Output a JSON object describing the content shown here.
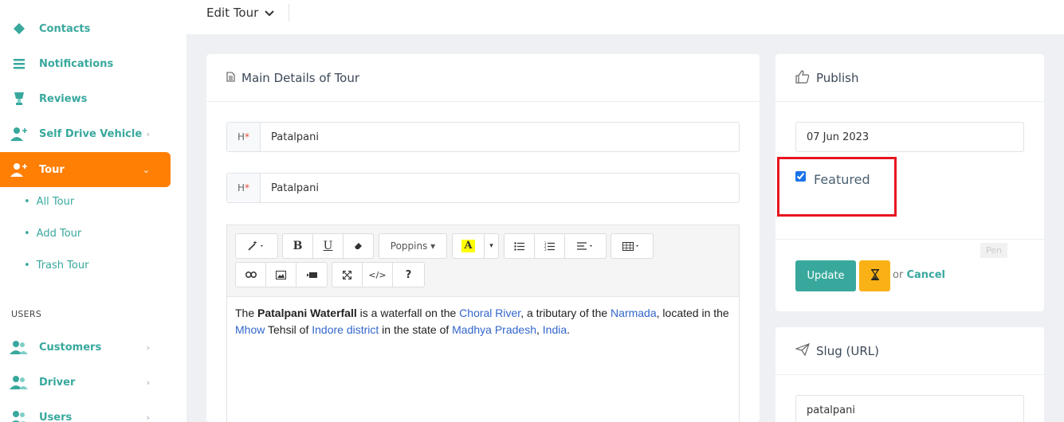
{
  "sidebar": {
    "items": [
      {
        "label": "Contacts",
        "icon": "layers-icon"
      },
      {
        "label": "Notifications",
        "icon": "list-icon"
      },
      {
        "label": "Reviews",
        "icon": "trophy-icon"
      },
      {
        "label": "Self Drive Vehicle",
        "icon": "user-plus-icon"
      },
      {
        "label": "Tour",
        "icon": "user-plus-icon"
      }
    ],
    "tour_sub": [
      "All Tour",
      "Add Tour",
      "Trash Tour"
    ],
    "users_section": "USERS",
    "user_items": [
      {
        "label": "Customers",
        "icon": "users-icon"
      },
      {
        "label": "Driver",
        "icon": "users-icon"
      },
      {
        "label": "Users",
        "icon": "users-icon"
      }
    ]
  },
  "header": {
    "title": "Edit Tour"
  },
  "main": {
    "card_title": "Main Details of Tour",
    "fields": [
      {
        "addon": "H",
        "value": "Patalpani"
      },
      {
        "addon": "H",
        "value": "Patalpani"
      }
    ],
    "editor": {
      "font_name": "Poppins",
      "content": {
        "p1": "The ",
        "b1": "Patalpani Waterfall",
        "p2": " is a waterfall on the ",
        "l1": "Choral River",
        "p3": ", a tributary of the ",
        "l2": "Narmada",
        "p4": ", located in the ",
        "l3": "Mhow",
        "p5": " Tehsil of ",
        "l4": "Indore district",
        "p6": " in the state of ",
        "l5": "Madhya Pradesh",
        "p7": ", ",
        "l6": "India",
        "p8": "."
      }
    }
  },
  "publish": {
    "title": "Publish",
    "date": "07 Jun 2023",
    "featured_label": "Featured",
    "featured_checked": true,
    "tooltip": "Pen",
    "update_label": "Update",
    "or_text": "or",
    "cancel_label": "Cancel"
  },
  "slug": {
    "title": "Slug (URL)",
    "value": "patalpani"
  },
  "colors": {
    "accent": "#38a89d",
    "active": "#ff7f05",
    "warning": "#f9b115",
    "highlight": "#e8141f"
  }
}
